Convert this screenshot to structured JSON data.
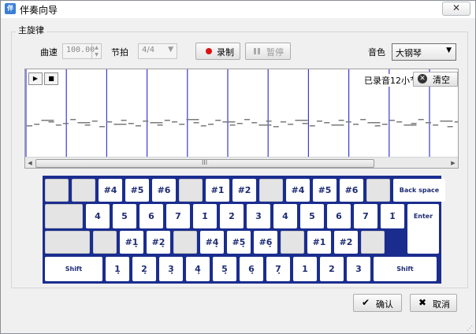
{
  "window": {
    "title": "伴奏向导",
    "app_icon_text": "伴",
    "close_glyph": "✕"
  },
  "group": {
    "title": "主旋律"
  },
  "controls": {
    "tempo_label": "曲速",
    "tempo_value": "100.00",
    "meter_label": "节拍",
    "meter_value": "4/4",
    "record_label": "录制",
    "pause_label": "暂停",
    "voice_label": "音色",
    "voice_value": "大钢琴"
  },
  "roll": {
    "play_glyph": "▶",
    "stop_glyph": "■",
    "recorded_info": "已录音12小节",
    "clear_label": "清空",
    "clear_icon_glyph": "✕",
    "scroll_grip": "III",
    "scroll_left_glyph": "◀",
    "scroll_right_glyph": "▶",
    "bar_line_color": "#3a3ad6",
    "note_color": "#7a7a7a"
  },
  "keyboard": {
    "rows": [
      [
        "",
        "",
        "#4",
        "#5",
        "#6",
        "",
        "#1̇",
        "#2̇",
        "",
        "#4̇",
        "#5̇",
        "#6̇",
        "",
        "Back space"
      ],
      [
        "",
        "4",
        "5",
        "6",
        "7",
        "1̇",
        "2̇",
        "3̇",
        "4̇",
        "5̇",
        "6̇",
        "7̇",
        "1̈",
        "Enter"
      ],
      [
        "",
        "",
        "#1̣",
        "#2̣",
        "",
        "#4̣",
        "#5̣",
        "#6̣",
        "",
        "#1",
        "#2",
        ""
      ],
      [
        "Shift",
        "1̣",
        "2̣",
        "3̣",
        "4̣",
        "5̣",
        "6̣",
        "7̣",
        "1",
        "2",
        "3",
        "Shift"
      ]
    ],
    "bg_color": "#1a2d8f",
    "key_text_color": "#1e2c74"
  },
  "buttons": {
    "ok_label": "确认",
    "ok_glyph": "✔",
    "cancel_label": "取消",
    "cancel_glyph": "✖"
  }
}
